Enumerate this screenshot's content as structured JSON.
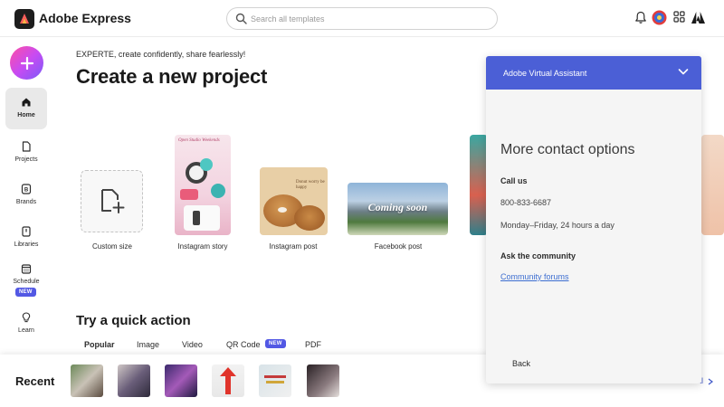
{
  "app": {
    "name": "Adobe Express"
  },
  "search": {
    "placeholder": "Search all templates"
  },
  "header_icons": [
    "bell-icon",
    "avatar",
    "apps-grid-icon",
    "adobe-logo-icon"
  ],
  "sidebar": {
    "items": [
      {
        "label": "Home",
        "icon": "home-icon",
        "active": true
      },
      {
        "label": "Projects",
        "icon": "document-icon"
      },
      {
        "label": "Brands",
        "icon": "brand-icon"
      },
      {
        "label": "Libraries",
        "icon": "library-icon"
      },
      {
        "label": "Schedule",
        "icon": "calendar-icon",
        "badge": "NEW"
      },
      {
        "label": "Learn",
        "icon": "lightbulb-icon"
      }
    ]
  },
  "main": {
    "tagline": "EXPERTE, create confidently, share fearlessly!",
    "title": "Create a new project",
    "cards": [
      {
        "label": "Custom size"
      },
      {
        "label": "Instagram story",
        "thumb_text": "Open Studio Weekends"
      },
      {
        "label": "Instagram post",
        "thumb_text": "Donut worry be happy"
      },
      {
        "label": "Facebook post",
        "thumb_text": "Coming soon"
      }
    ],
    "quick_action": {
      "title": "Try a quick action",
      "tabs": [
        {
          "label": "Popular",
          "active": true
        },
        {
          "label": "Image"
        },
        {
          "label": "Video"
        },
        {
          "label": "QR Code",
          "badge": "NEW"
        },
        {
          "label": "PDF"
        }
      ]
    }
  },
  "recent": {
    "title": "Recent",
    "see_all": "al",
    "thumb_count": 6
  },
  "assistant": {
    "title": "Adobe Virtual Assistant",
    "heading": "More contact options",
    "call_us": "Call us",
    "phone": "800-833-6687",
    "hours": "Monday–Friday, 24 hours a day",
    "community_heading": "Ask the community",
    "community_link": "Community forums",
    "back": "Back"
  },
  "colors": {
    "accent": "#4b5fd6",
    "badge": "#5258e4",
    "link": "#3d6ed1"
  }
}
